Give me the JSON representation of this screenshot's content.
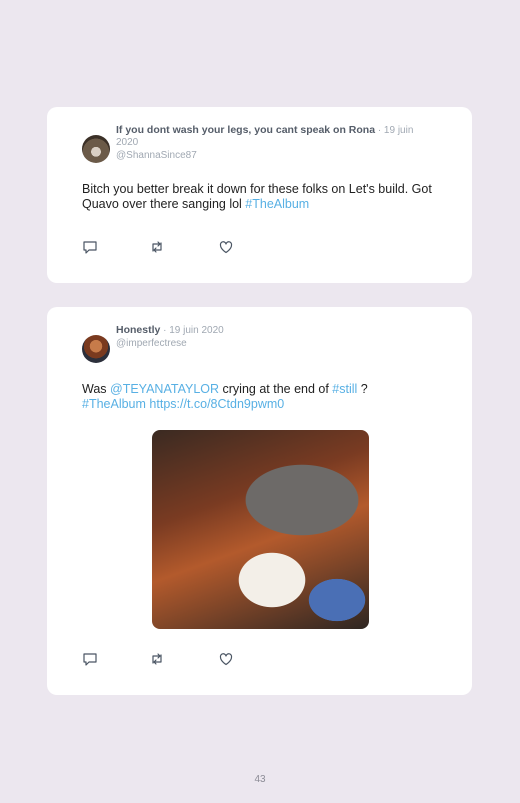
{
  "tweets": [
    {
      "author_name": "If you dont wash your legs, you cant speak on Rona",
      "date": "· 19 juin 2020",
      "handle": "@ShannaSince87",
      "text_parts": [
        "Bitch you better break it down for these folks on Let's build. Got Quavo over there sanging lol "
      ],
      "hashtag": "#TheAlbum"
    },
    {
      "author_name": "Honestly",
      "date": "· 19 juin 2020",
      "handle": "@imperfectrese",
      "text_1": "Was ",
      "mention": "@TEYANATAYLOR",
      "text_2": " crying at the end of ",
      "hashtag_1": "#still",
      "text_3": " ?",
      "hashtag_2": "#TheAlbum",
      "link": "https://t.co/8Ctdn9pwm0"
    }
  ],
  "icons": [
    "reply-icon",
    "retweet-icon",
    "like-icon"
  ],
  "colors": {
    "background": "#ece7ef",
    "card": "#ffffff",
    "link": "#58b0e4"
  },
  "page_number": "43"
}
